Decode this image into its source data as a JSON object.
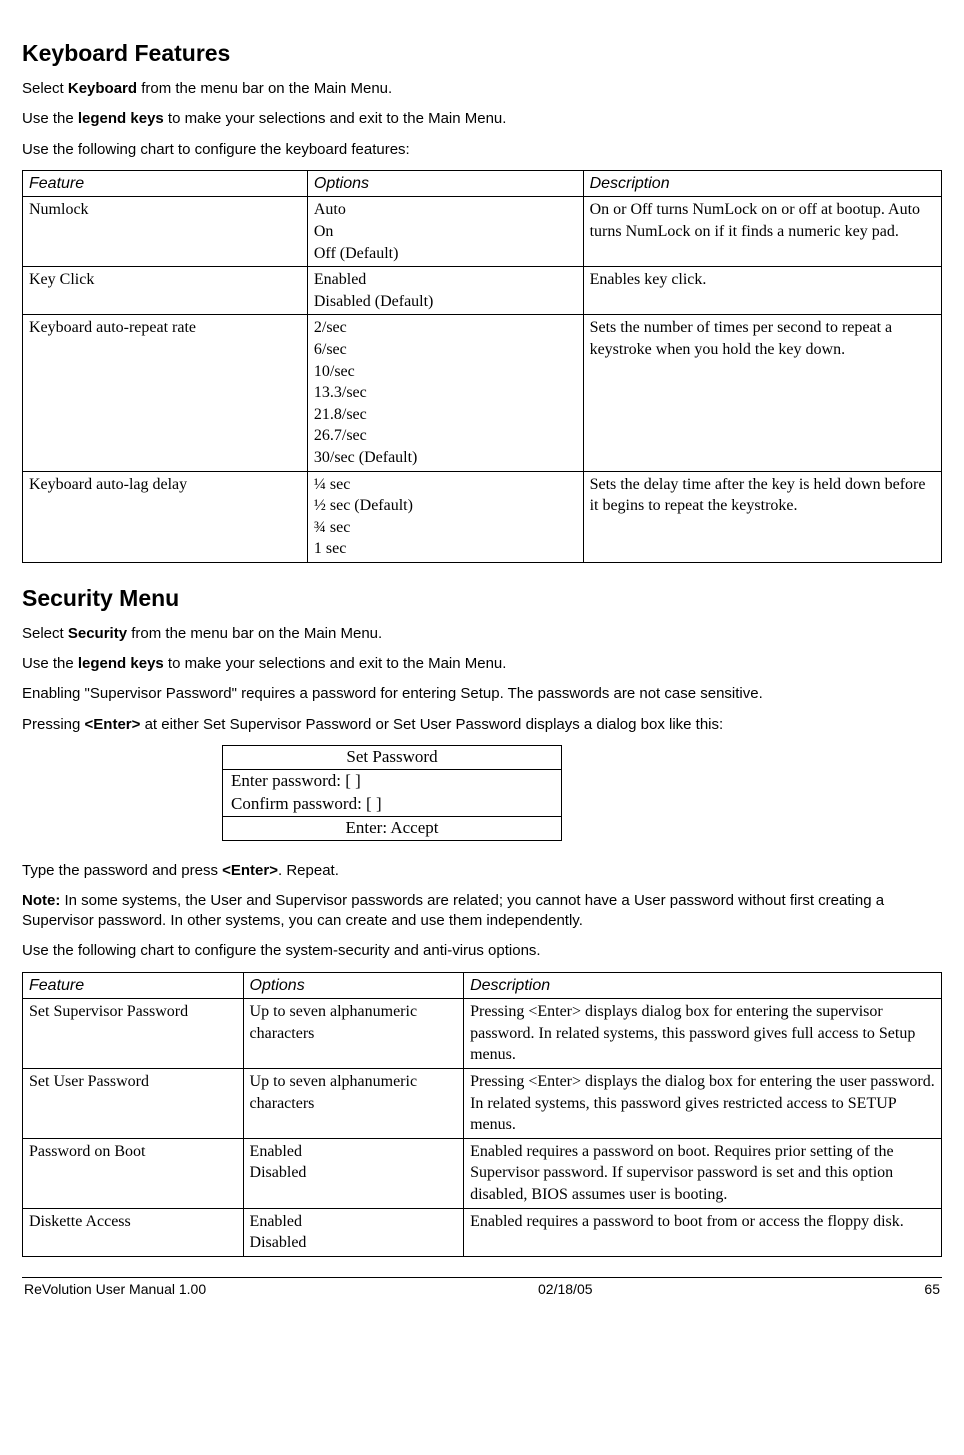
{
  "section1": {
    "heading": "Keyboard Features",
    "p1_pre": "Select ",
    "p1_bold": "Keyboard",
    "p1_post": " from the menu bar on the Main Menu.",
    "p2_pre": "Use the ",
    "p2_bold": "legend keys",
    "p2_post": " to make your selections and exit to the Main Menu.",
    "p3": "Use the following chart to configure the keyboard features:"
  },
  "table1": {
    "h_feature": "Feature",
    "h_options": "Options",
    "h_description": "Description",
    "r1": {
      "feature": "Numlock",
      "options": "Auto\nOn\nOff (Default)",
      "description": "On or Off turns NumLock on or off at bootup. Auto turns NumLock on if it finds a numeric key pad."
    },
    "r2": {
      "feature": "Key Click",
      "options": "Enabled\nDisabled (Default)",
      "description": "Enables key click."
    },
    "r3": {
      "feature": "Keyboard auto-repeat rate",
      "options": "2/sec\n6/sec\n10/sec\n13.3/sec\n21.8/sec\n26.7/sec\n30/sec (Default)",
      "description": "Sets the number of times per second to repeat a keystroke when you hold the key down."
    },
    "r4": {
      "feature": "Keyboard auto-lag delay",
      "options": "¼ sec\n½ sec (Default)\n¾ sec\n1 sec",
      "description": "Sets the delay time after the key is held down before it begins to repeat the keystroke."
    }
  },
  "section2": {
    "heading": "Security Menu",
    "p1_pre": "Select ",
    "p1_bold": "Security",
    "p1_post": " from the menu bar on the Main Menu.",
    "p2_pre": "Use the ",
    "p2_bold": "legend keys",
    "p2_post": " to make your selections and exit to the Main Menu.",
    "p3": "Enabling \"Supervisor Password\" requires a password for entering Setup. The passwords are not case sensitive.",
    "p4_pre": "Pressing ",
    "p4_bold": "<Enter>",
    "p4_post": " at either Set Supervisor Password or Set User Password displays a dialog box like this:"
  },
  "pwbox": {
    "title": "Set Password",
    "row_enter": "Enter password:      [                    ]",
    "row_confirm": "Confirm password: [                    ]",
    "row_accept": "Enter: Accept"
  },
  "section3": {
    "p1_pre": "Type the password and press ",
    "p1_bold": "<Enter>",
    "p1_post": ". Repeat.",
    "note_bold": "Note:",
    "note_text": " In some systems, the User and Supervisor passwords are related; you cannot have a User password without first creating a Supervisor password. In other systems, you can create and use them independently.",
    "p3": "Use the following chart to configure the system-security and anti-virus options."
  },
  "table2": {
    "h_feature": "Feature",
    "h_options": "Options",
    "h_description": "Description",
    "r1": {
      "feature": "Set Supervisor Password",
      "options": "Up to seven alphanumeric characters",
      "description": "Pressing <Enter> displays dialog box for entering the supervisor password. In related systems, this password gives full access to Setup menus."
    },
    "r2": {
      "feature": "Set User Password",
      "options": "Up to seven alphanumeric characters",
      "description": "Pressing <Enter> displays the dialog box for entering the user password. In related systems, this password gives restricted access to SETUP menus."
    },
    "r3": {
      "feature": "Password on Boot",
      "options": "Enabled\nDisabled",
      "description": "Enabled requires a password on boot. Requires prior setting of the Supervisor password. If supervisor password is set and this option disabled, BIOS assumes user is booting."
    },
    "r4": {
      "feature": "Diskette Access",
      "options": "Enabled\nDisabled",
      "description": "Enabled requires a password to boot from or access the floppy disk."
    }
  },
  "footer": {
    "left": "ReVolution User Manual 1.00",
    "center": "02/18/05",
    "right": "65"
  }
}
